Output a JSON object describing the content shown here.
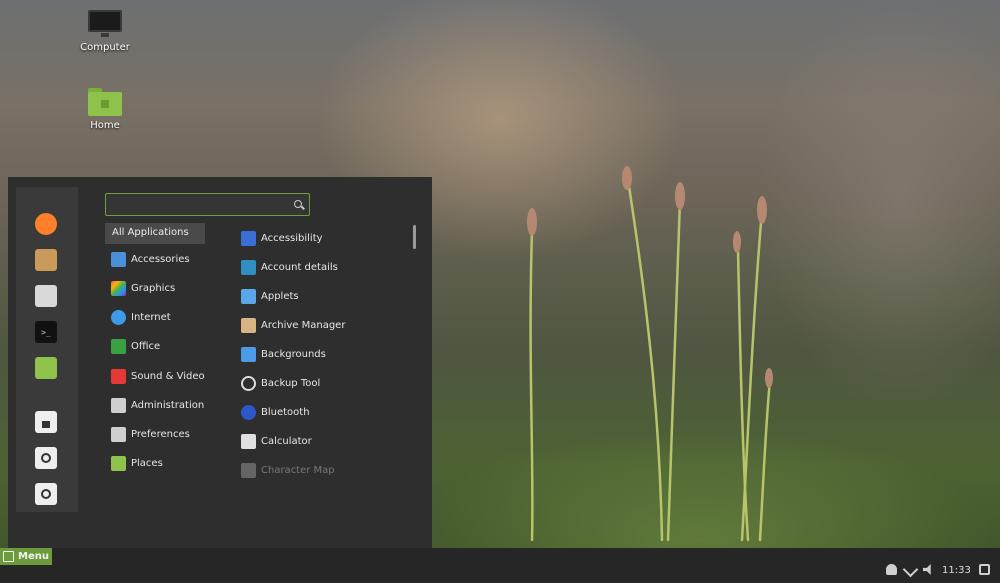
{
  "desktop": {
    "icons": [
      {
        "label": "Computer",
        "icon": "computer-icon"
      },
      {
        "label": "Home",
        "icon": "home-folder-icon"
      }
    ]
  },
  "menu": {
    "search": {
      "value": "",
      "placeholder": ""
    },
    "favorites": [
      {
        "name": "firefox",
        "icon": "firefox-icon",
        "color": "#ff7f2a"
      },
      {
        "name": "software-manager",
        "icon": "package-icon",
        "color": "#c99a5a"
      },
      {
        "name": "system-settings",
        "icon": "settings-icon",
        "color": "#d9d9d9"
      },
      {
        "name": "terminal",
        "icon": "terminal-icon",
        "color": "#111111"
      },
      {
        "name": "files",
        "icon": "folder-icon",
        "color": "#8fc24b"
      },
      {
        "name": "lock-screen",
        "icon": "lock-icon",
        "color": "#eeeeee"
      },
      {
        "name": "logout",
        "icon": "logout-icon",
        "color": "#eeeeee"
      },
      {
        "name": "shutdown",
        "icon": "power-icon",
        "color": "#eeeeee"
      }
    ],
    "categories": [
      {
        "label": "All Applications",
        "selected": true
      },
      {
        "label": "Accessories",
        "icon": "accessories-icon",
        "color": "#4a90d9"
      },
      {
        "label": "Graphics",
        "icon": "graphics-icon",
        "color": "#d04fb0"
      },
      {
        "label": "Internet",
        "icon": "internet-icon",
        "color": "#3d9be9"
      },
      {
        "label": "Office",
        "icon": "office-icon",
        "color": "#3aa142"
      },
      {
        "label": "Sound & Video",
        "icon": "sound-video-icon",
        "color": "#e53935"
      },
      {
        "label": "Administration",
        "icon": "administration-icon",
        "color": "#cfcfcf"
      },
      {
        "label": "Preferences",
        "icon": "preferences-icon",
        "color": "#cfcfcf"
      },
      {
        "label": "Places",
        "icon": "places-folder-icon",
        "color": "#8fc24b"
      }
    ],
    "apps": [
      {
        "label": "Accessibility",
        "icon": "accessibility-icon",
        "color": "#3b6fd8"
      },
      {
        "label": "Account details",
        "icon": "account-icon",
        "color": "#2f8fc0"
      },
      {
        "label": "Applets",
        "icon": "applets-icon",
        "color": "#5aa6e8"
      },
      {
        "label": "Archive Manager",
        "icon": "archive-icon",
        "color": "#d8b483"
      },
      {
        "label": "Backgrounds",
        "icon": "backgrounds-icon",
        "color": "#4b9be8"
      },
      {
        "label": "Backup Tool",
        "icon": "backup-icon",
        "color": "#dddddd"
      },
      {
        "label": "Bluetooth",
        "icon": "bluetooth-icon",
        "color": "#2e56c9"
      },
      {
        "label": "Calculator",
        "icon": "calculator-icon",
        "color": "#e0e0e0"
      },
      {
        "label": "Character Map",
        "icon": "character-map-icon",
        "color": "#8a8a8a",
        "dim": true
      }
    ]
  },
  "panel": {
    "menu_label": "Menu",
    "clock": "11:33"
  }
}
